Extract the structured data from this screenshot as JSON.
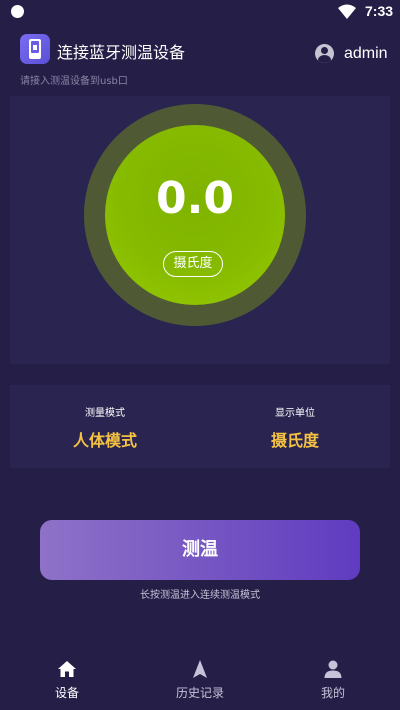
{
  "status_bar": {
    "time": "7:33",
    "icons": [
      "notification-dot-icon",
      "wifi-icon",
      "battery-icon"
    ]
  },
  "header": {
    "title": "连接蓝牙测温设备",
    "subtitle": "请接入测温设备到usb口",
    "username": "admin",
    "icons": {
      "app": "phone-icon",
      "user": "user-icon"
    }
  },
  "gauge": {
    "value": "0.0",
    "unit": "摄氏度",
    "colors": {
      "ring": "#4f5a35",
      "fill": "#99cc00"
    }
  },
  "mode": {
    "measure_mode_label": "测量模式",
    "measure_mode_value": "人体模式",
    "display_unit_label": "显示单位",
    "display_unit_value": "摄氏度",
    "value_color": "#f5c242"
  },
  "action": {
    "measure_label": "测温",
    "hint": "长按测温进入连续测温模式"
  },
  "bottom_nav": {
    "items": [
      {
        "label": "设备",
        "icon": "home-icon",
        "active": true
      },
      {
        "label": "历史记录",
        "icon": "navigation-arrow-icon",
        "active": false
      },
      {
        "label": "我的",
        "icon": "person-icon",
        "active": false
      }
    ]
  },
  "colors": {
    "background": "#251f47",
    "panel": "#2a2450",
    "accent": "#7252c2"
  }
}
